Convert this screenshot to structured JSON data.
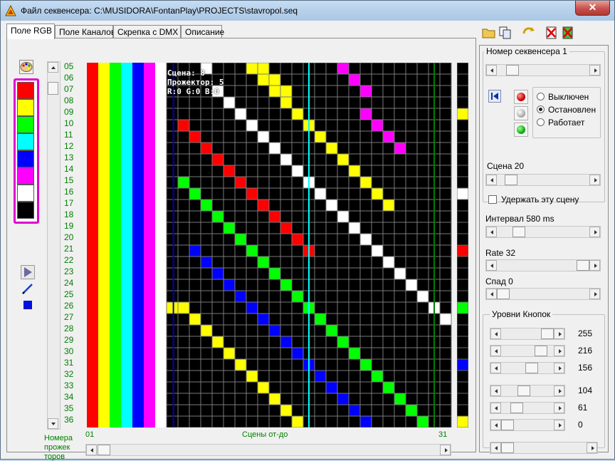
{
  "window": {
    "title": "Файл секвенсера: C:\\MUSIDORA\\FontanPlay\\PROJECTS\\stavropol.seq",
    "close_label": "✕"
  },
  "tabs": [
    {
      "label": "Поле RGB",
      "active": true
    },
    {
      "label": "Поле Каналов",
      "active": false
    },
    {
      "label": "Скрепка с DMX",
      "active": false
    },
    {
      "label": "Описание",
      "active": false
    }
  ],
  "palette": {
    "icon": "palette-icon",
    "colors": [
      "#ff0000",
      "#ffff00",
      "#00ff00",
      "#00ffff",
      "#0000ff",
      "#ff00ff",
      "#ffffff",
      "#000000"
    ]
  },
  "tools": [
    "play-cursor-icon",
    "pencil-icon",
    "fill-square-icon"
  ],
  "projector_rows": [
    "05",
    "06",
    "07",
    "08",
    "09",
    "10",
    "11",
    "12",
    "13",
    "14",
    "15",
    "16",
    "17",
    "18",
    "19",
    "20",
    "21",
    "22",
    "23",
    "24",
    "25",
    "26",
    "27",
    "28",
    "29",
    "30",
    "31",
    "32",
    "33",
    "34",
    "35",
    "36"
  ],
  "projector_caption": [
    "Номера",
    "прожек",
    "торов"
  ],
  "grid": {
    "left_columns": [
      "#ff0000",
      "#ffff00",
      "#00ff00",
      "#00ffff",
      "#0000ff",
      "#ff00ff",
      "#ffffff"
    ],
    "scene_from": "01",
    "scene_to": "31",
    "scene_caption": "Сцены от-до",
    "overlay": [
      "Сцена: 8",
      "Прожектор: 5",
      "R:0 G:0 B:0"
    ]
  },
  "right_preview_colors": {
    "9": "#ffff00",
    "16": "#ffffff",
    "21": "#ff0000",
    "26": "#00ff00",
    "31": "#0000ff",
    "36": "#ffff00"
  },
  "toolbar": [
    "open-folder-icon",
    "copy-icon",
    "export-icon",
    "delete-icon",
    "clear-icon"
  ],
  "sequencer": {
    "label": "Номер секвенсера 1",
    "state_options": [
      "Выключен",
      "Остановлен",
      "Работает"
    ],
    "selected_state": 1
  },
  "scene": {
    "label": "Сцена 20",
    "hold_label": "Удержать эту сцену",
    "hold_checked": false
  },
  "interval": {
    "label": "Интервал 580 ms"
  },
  "rate": {
    "label": "Rate 32"
  },
  "decay": {
    "label": "Спад 0"
  },
  "button_levels": {
    "title": "Уровни Кнопок",
    "levels": [
      {
        "value": "255",
        "fraction": 1.0
      },
      {
        "value": "216",
        "fraction": 0.847
      },
      {
        "value": "156",
        "fraction": 0.612
      },
      {
        "value": "104",
        "fraction": 0.408
      },
      {
        "value": "61",
        "fraction": 0.239
      },
      {
        "value": "0",
        "fraction": 0.0
      },
      {
        "value": "",
        "fraction": 0.0
      }
    ]
  }
}
